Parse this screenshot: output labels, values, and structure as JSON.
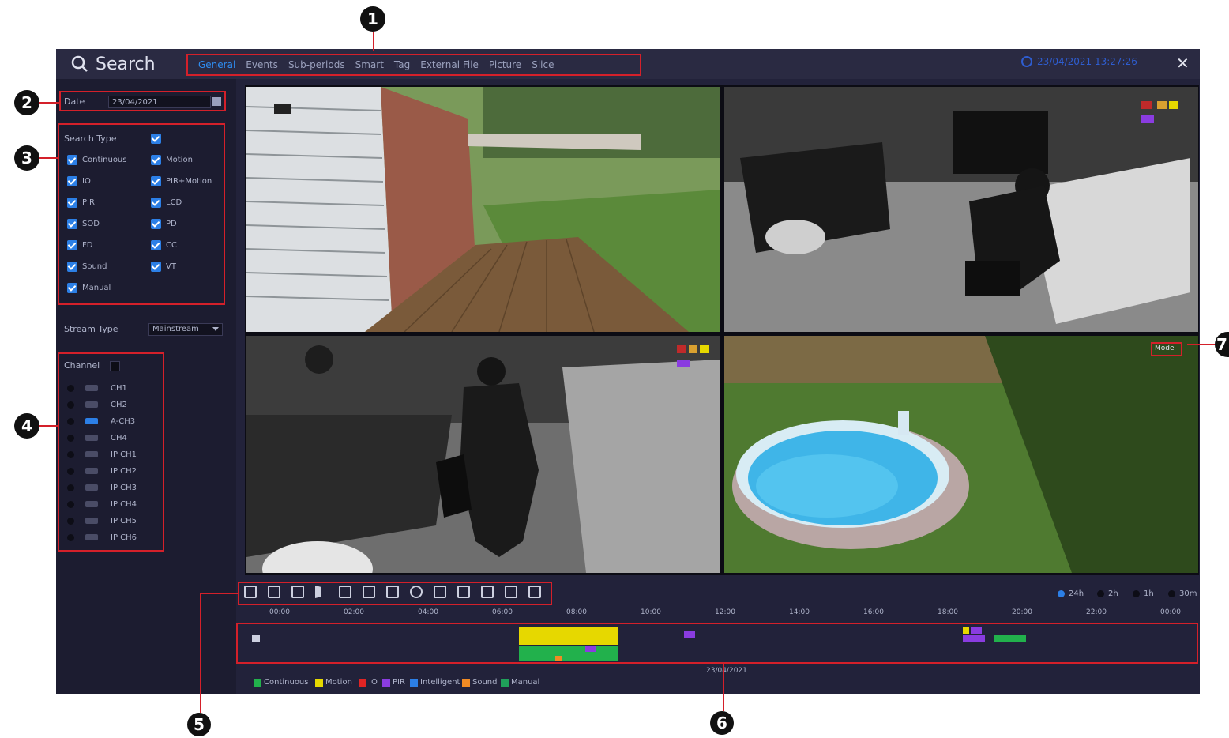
{
  "header": {
    "title": "Search",
    "tabs": [
      "General",
      "Events",
      "Sub-periods",
      "Smart",
      "Tag",
      "External File",
      "Picture",
      "Slice"
    ],
    "datetime": "23/04/2021 13:27:26"
  },
  "sidebar": {
    "date_label": "Date",
    "date_value": "23/04/2021",
    "search_type_label": "Search Type",
    "search_types": [
      "Continuous",
      "Motion",
      "IO",
      "PIR+Motion",
      "PIR",
      "LCD",
      "SOD",
      "PD",
      "FD",
      "CC",
      "Sound",
      "VT",
      "Manual"
    ],
    "stream_type_label": "Stream Type",
    "stream_type_value": "Mainstream",
    "channel_label": "Channel",
    "channels": [
      "CH1",
      "CH2",
      "A-CH3",
      "CH4",
      "IP CH1",
      "IP CH2",
      "IP CH3",
      "IP CH4",
      "IP CH5",
      "IP CH6"
    ]
  },
  "video": {
    "mode_badge": "Mode"
  },
  "timeline": {
    "zoom_options": [
      "24h",
      "2h",
      "1h",
      "30m"
    ],
    "ticks": [
      "00:00",
      "02:00",
      "04:00",
      "06:00",
      "08:00",
      "10:00",
      "12:00",
      "14:00",
      "16:00",
      "18:00",
      "20:00",
      "22:00",
      "00:00"
    ],
    "date": "23/04/2021",
    "legend": [
      "Continuous",
      "Motion",
      "IO",
      "PIR",
      "Intelligent",
      "Sound",
      "Manual"
    ]
  },
  "callouts": [
    "1",
    "2",
    "3",
    "4",
    "5",
    "6",
    "7"
  ],
  "colors": {
    "accent": "#2e8cf0",
    "highlight_border": "#d4202a",
    "continuous": "#22b14c",
    "motion": "#e6d800",
    "io": "#e02424",
    "pir": "#8a3ce0",
    "intelligent": "#2c7fe6",
    "sound": "#f08a24",
    "manual": "#1fa05a"
  }
}
